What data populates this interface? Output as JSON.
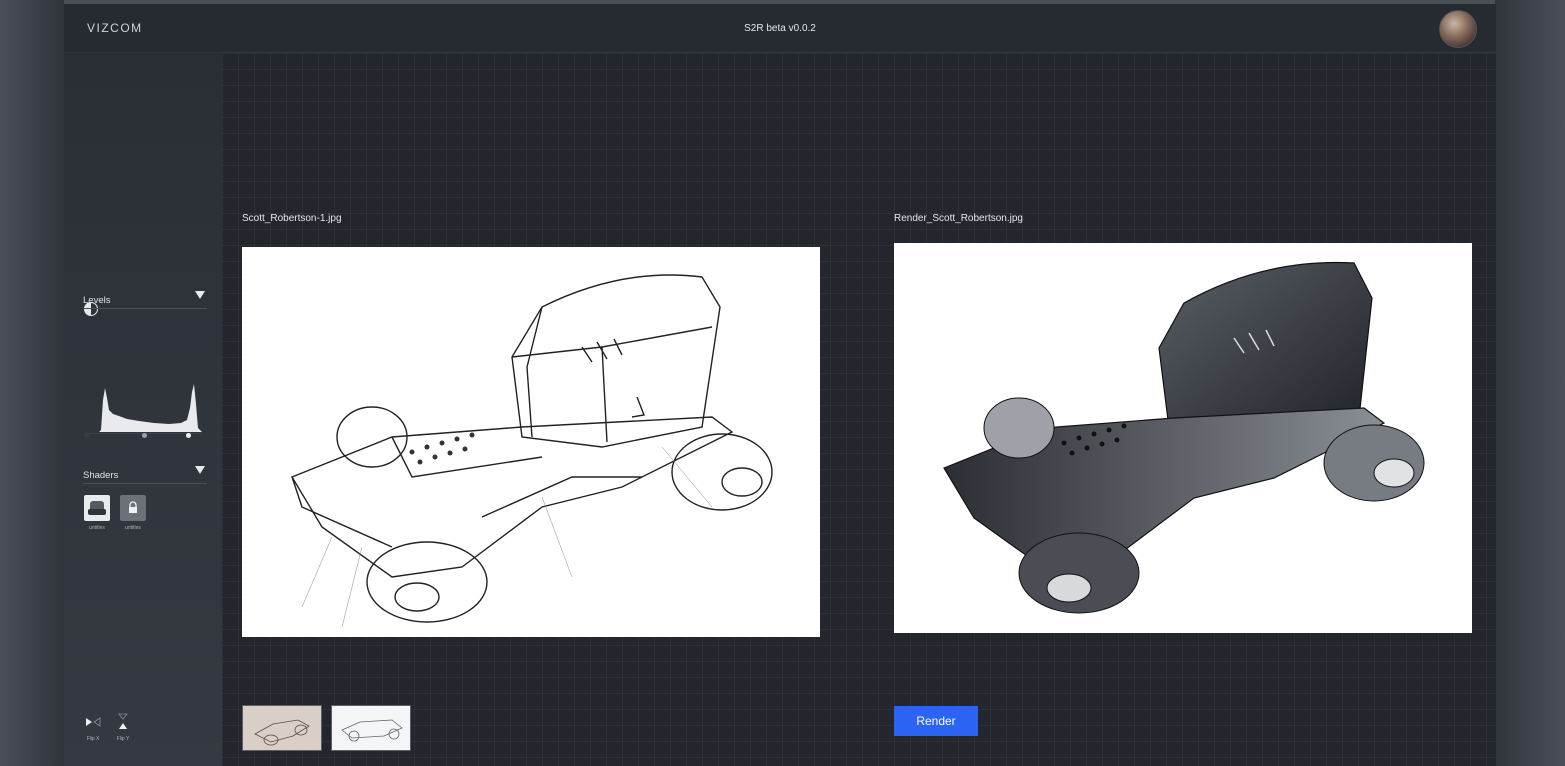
{
  "header": {
    "logo": "VIZCOM",
    "title": "S2R beta v0.0.2"
  },
  "sidebar": {
    "levels_label": "Levels",
    "shaders_label": "Shaders",
    "shaders": [
      {
        "caption": "untitles"
      },
      {
        "caption": "untitles"
      }
    ],
    "flip_x_label": "Flip X",
    "flip_y_label": "Flip Y"
  },
  "main": {
    "source_filename": "Scott_Robertson-1.jpg",
    "render_filename": "Render_Scott_Robertson.jpg",
    "render_button": "Render"
  },
  "colors": {
    "accent": "#2b63f2",
    "background": "#23262d"
  }
}
